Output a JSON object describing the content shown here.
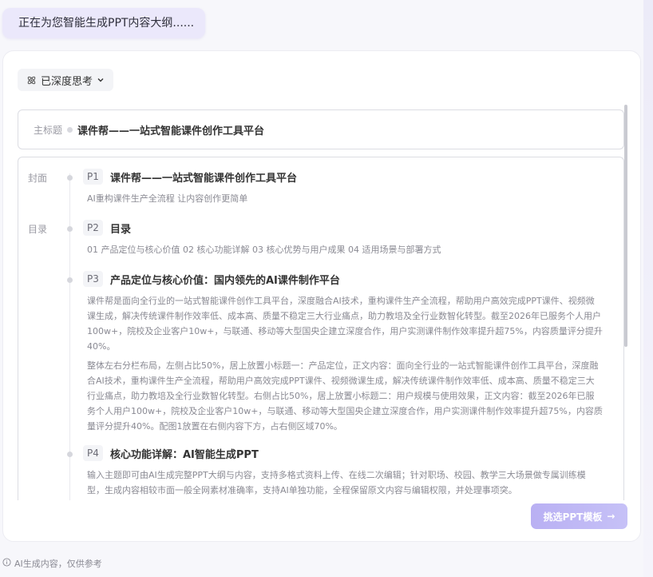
{
  "status_message": "正在为您智能生成PPT内容大纲......",
  "thinking_toggle": {
    "label": "已深度思考",
    "icon": "atom-icon",
    "chevron": "chevron-down-icon"
  },
  "main_title": {
    "label": "主标题",
    "value": "课件帮——一站式智能课件创作工具平台"
  },
  "sections": {
    "cover": "封面",
    "toc": "目录"
  },
  "slides": [
    {
      "num": "P1",
      "title": "课件帮——一站式智能课件创作工具平台",
      "desc": "AI重构课件生产全流程 让内容创作更简单"
    },
    {
      "num": "P2",
      "title": "目录",
      "desc": "01 产品定位与核心价值 02 核心功能详解 03 核心优势与用户成果 04 适用场景与部署方式"
    },
    {
      "num": "P3",
      "title": "产品定位与核心价值：国内领先的AI课件制作平台",
      "desc": "课件帮是面向全行业的一站式智能课件创作工具平台，深度融合AI技术，重构课件生产全流程，帮助用户高效完成PPT课件、视频微课生成，解决传统课件制作效率低、成本高、质量不稳定三大行业痛点，助力教培及全行业数智化转型。截至2026年已服务个人用户100w+，院校及企业客户10w+，与联通、移动等大型国央企建立深度合作，用户实测课件制作效率提升超75%，内容质量评分提升40%。",
      "desc2": "整体左右分栏布局，左侧占比50%，居上放置小标题一：产品定位，正文内容：面向全行业的一站式智能课件创作工具平台，深度融合AI技术，重构课件生产全流程，帮助用户高效完成PPT课件、视频微课生成，解决传统课件制作效率低、成本高、质量不稳定三大行业痛点，助力教培及全行业数智化转型。右侧占比50%，居上放置小标题二：用户规模与使用效果，正文内容：截至2026年已服务个人用户100w+，院校及企业客户10w+，与联通、移动等大型国央企建立深度合作，用户实测课件制作效率提升超75%，内容质量评分提升40%。配图1放置在右侧内容下方，占右侧区域70%。"
    },
    {
      "num": "P4",
      "title": "核心功能详解：AI智能生成PPT",
      "desc": "输入主题即可由AI生成完整PPT大纲与内容，支持多格式资料上传、在线二次编辑；针对职场、校园、教学三大场景做专属训练模型，生成内容相较市面一般全网素材准确率，支持AI单独功能，全程保留原文内容与编辑权限，并处理事项突。"
    }
  ],
  "pick_template_button": {
    "label": "挑选PPT模板",
    "arrow": "→"
  },
  "disclaimer": {
    "icon": "info-icon",
    "text": "AI生成内容，仅供参考"
  },
  "colors": {
    "accent": "#b9b0f3",
    "bubble": "#ebe8fb",
    "muted": "#8a8a93"
  }
}
